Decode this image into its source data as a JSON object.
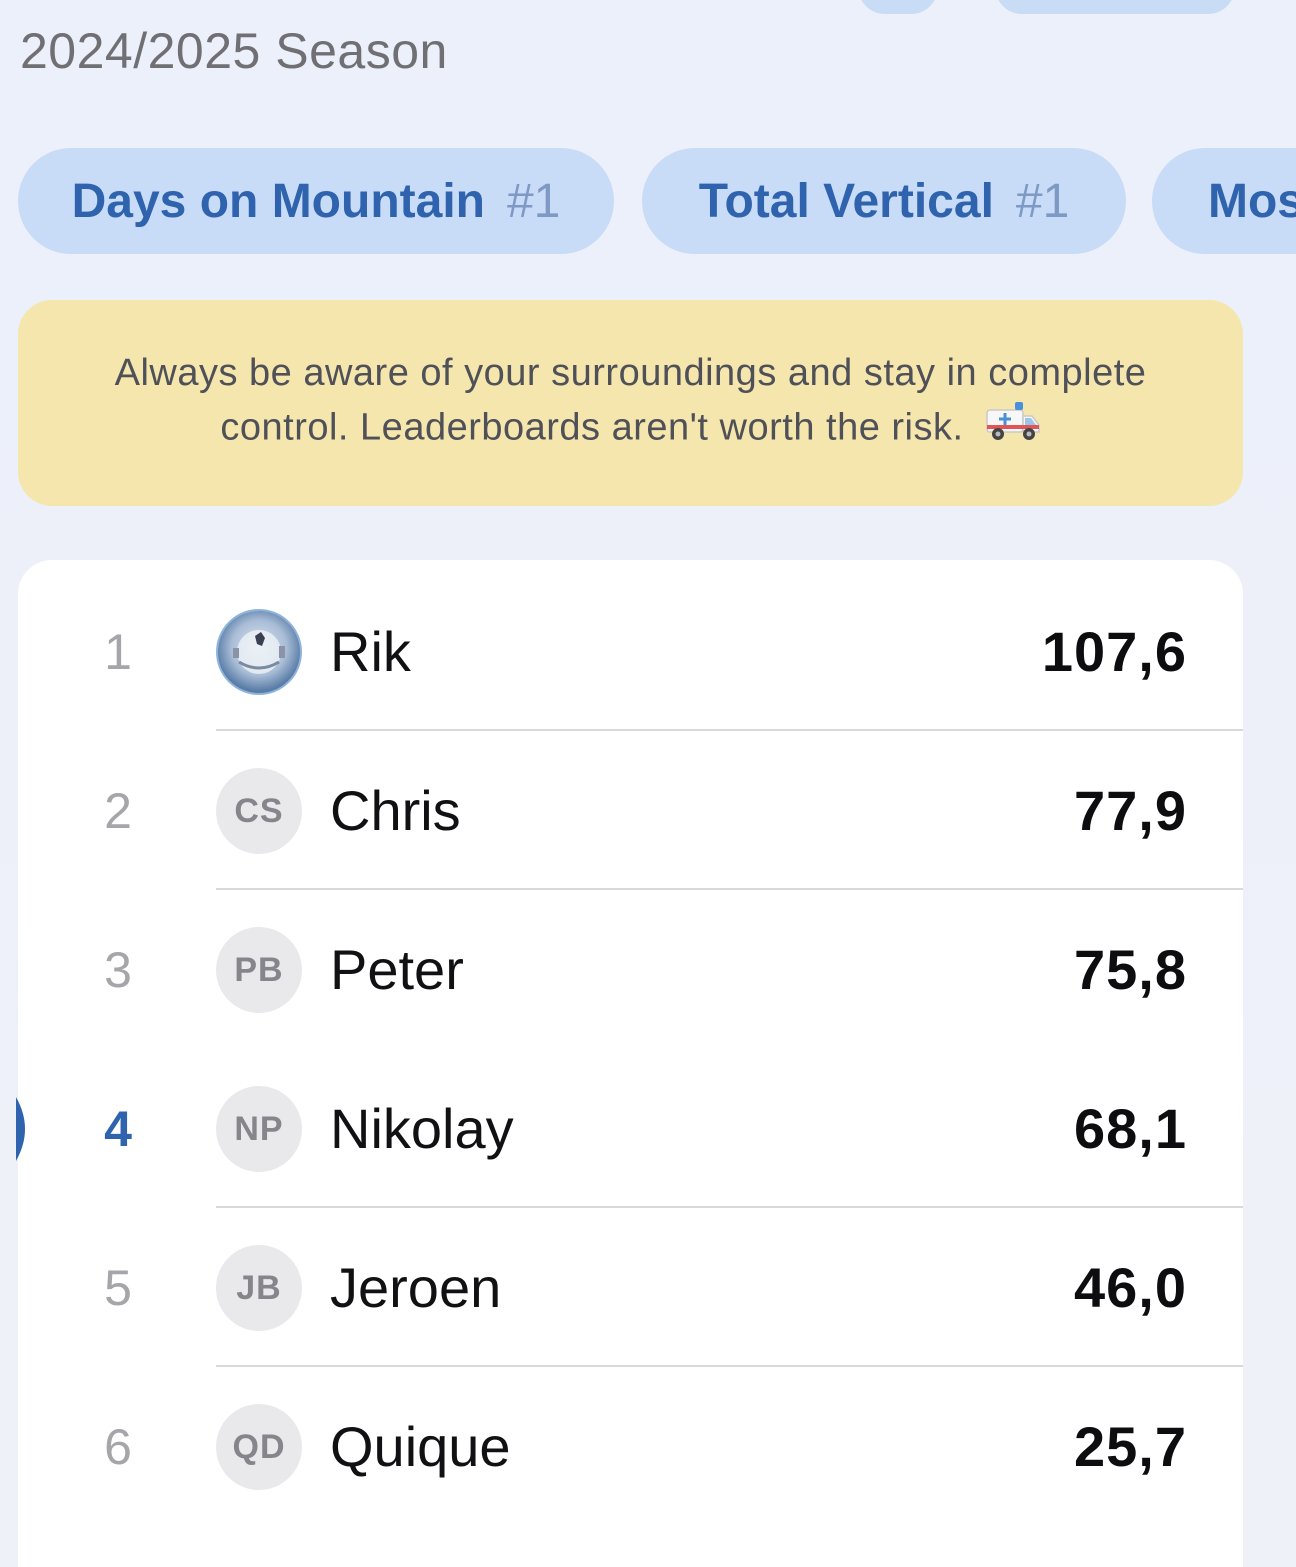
{
  "season": "2024/2025 Season",
  "categories": [
    {
      "label": "Days on Mountain",
      "rank": "#1"
    },
    {
      "label": "Total Vertical",
      "rank": "#1"
    },
    {
      "label": "Mos",
      "rank": ""
    }
  ],
  "banner": {
    "text": "Always be aware of your surroundings and stay in complete control. Leaderboards aren't worth the risk.",
    "icon": "ambulance-icon"
  },
  "colors": {
    "accent": "#2f63ad",
    "pill": "#c8dcf7",
    "banner": "#f4e6ad"
  },
  "leaderboard": [
    {
      "position": "1",
      "initials": "",
      "photo": true,
      "name": "Rik",
      "value": "107,6"
    },
    {
      "position": "2",
      "initials": "CS",
      "name": "Chris",
      "value": "77,9"
    },
    {
      "position": "3",
      "initials": "PB",
      "name": "Peter",
      "value": "75,8"
    },
    {
      "position": "4",
      "initials": "NP",
      "name": "Nikolay",
      "value": "68,1",
      "current_user": true
    },
    {
      "position": "5",
      "initials": "JB",
      "name": "Jeroen",
      "value": "46,0"
    },
    {
      "position": "6",
      "initials": "QD",
      "name": "Quique",
      "value": "25,7"
    }
  ]
}
